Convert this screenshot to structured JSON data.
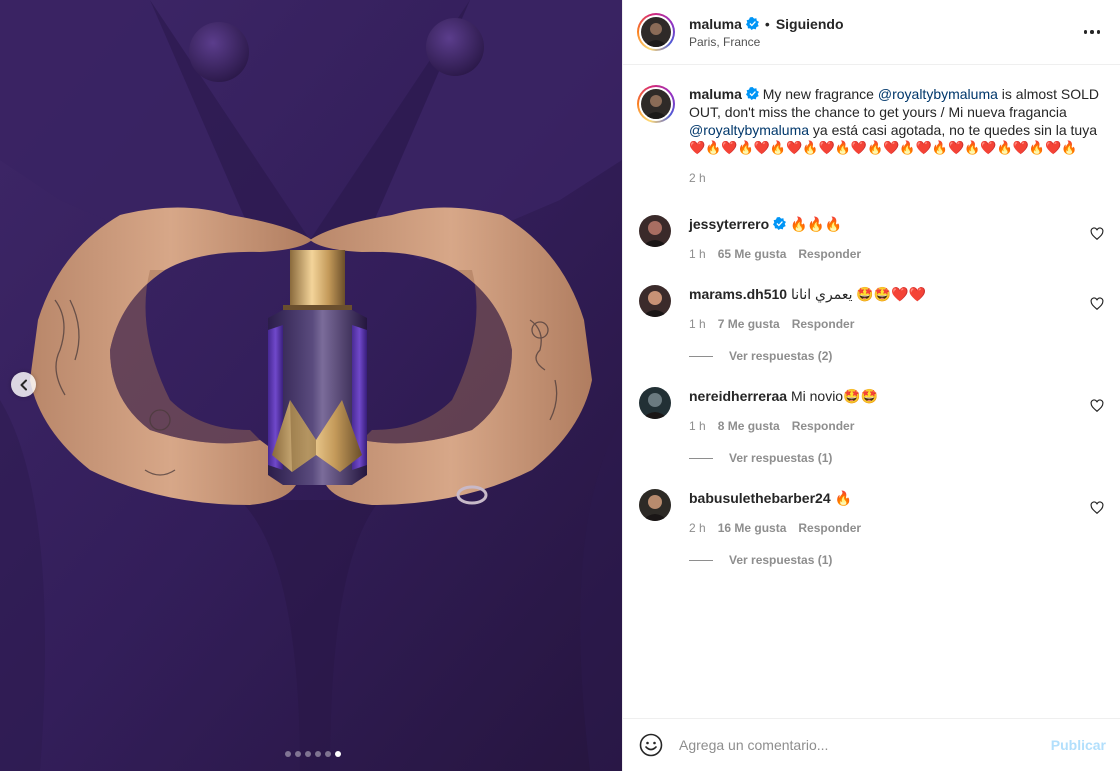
{
  "colors": {
    "accent": "#0095f6",
    "publish_disabled": "#b2dffc",
    "mention": "#00376b",
    "secondary_text": "#8e8e8e",
    "suit_purple": "#3b2362"
  },
  "media": {
    "carousel_dots": 6,
    "active_dot": 5,
    "prev_icon": "chevron-left-icon"
  },
  "header": {
    "username": "maluma",
    "verified": true,
    "separator": "•",
    "follow_status": "Siguiendo",
    "location": "Paris, France",
    "more_icon": "more-horizontal-icon"
  },
  "caption": {
    "username": "maluma",
    "text_1": "My new fragrance ",
    "mention_1": "@royaltybymaluma",
    "text_2": " is almost SOLD OUT, don't miss the chance to get yours / Mi nueva fragancia ",
    "mention_2": "@royaltybymaluma",
    "text_3": " ya está casi agotada, no te quedes sin la tuya",
    "emojis": "❤️🔥❤️🔥❤️🔥❤️🔥❤️🔥❤️🔥❤️🔥❤️🔥❤️🔥❤️🔥❤️🔥❤️🔥",
    "time": "2 h"
  },
  "comments": [
    {
      "username": "jessyterrero",
      "verified": true,
      "text": "🔥🔥🔥",
      "time": "1 h",
      "likes": "65 Me gusta",
      "reply": "Responder",
      "replies": ""
    },
    {
      "username": "marams.dh510",
      "verified": false,
      "text": "يعمري انانا 🤩🤩❤️❤️",
      "time": "1 h",
      "likes": "7 Me gusta",
      "reply": "Responder",
      "replies": "Ver respuestas (2)"
    },
    {
      "username": "nereidherreraa",
      "verified": false,
      "text": "Mi novio🤩🤩",
      "time": "1 h",
      "likes": "8 Me gusta",
      "reply": "Responder",
      "replies": "Ver respuestas (1)"
    },
    {
      "username": "babusulethebarber24",
      "verified": false,
      "text": "🔥",
      "time": "2 h",
      "likes": "16 Me gusta",
      "reply": "Responder",
      "replies": "Ver respuestas (1)"
    }
  ],
  "composer": {
    "placeholder": "Agrega un comentario...",
    "publish_label": "Publicar",
    "emoji_icon": "smile-icon"
  }
}
